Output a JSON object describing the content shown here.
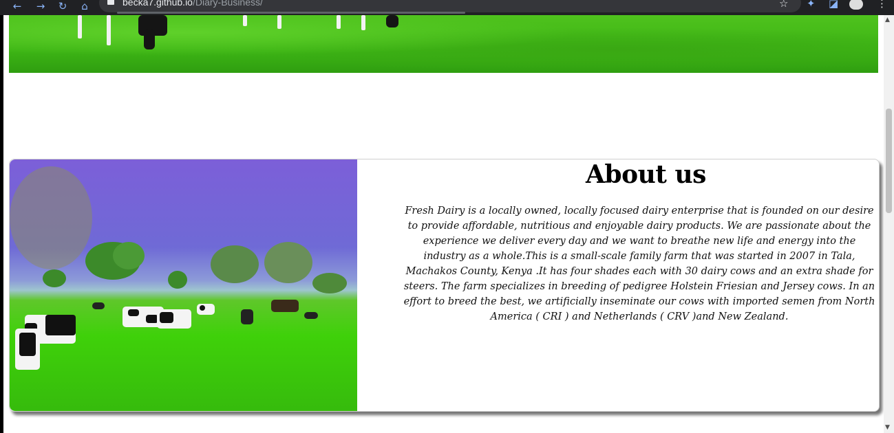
{
  "browser": {
    "url_host": "becka7.github.io",
    "url_path": "/Diary-Business/",
    "back_icon": "arrow-left-icon",
    "forward_icon": "arrow-right-icon",
    "reload_icon": "reload-icon",
    "home_icon": "home-icon",
    "lock_icon": "lock-icon",
    "star_icon": "star-icon",
    "extensions_icon": "puzzle-icon",
    "cast_icon": "cast-icon",
    "menu_icon": "kebab-menu-icon"
  },
  "about": {
    "title": "About us",
    "body": "Fresh Dairy is a locally owned, locally focused dairy enterprise that is founded on our desire to provide affordable, nutritious and enjoyable dairy products. We are passionate about the experience we deliver every day and we want to breathe new life and energy into the industry as a whole.This is a small-scale family farm that was started in 2007 in Tala, Machakos County, Kenya .It has four shades each with 30 dairy cows and an extra shade for steers. The farm specializes in breeding of pedigree Holstein Friesian and Jersey cows. In an effort to breed the best, we artificially inseminate our cows with imported semen from North America ( CRI ) and Netherlands ( CRV )and New Zealand."
  },
  "images": {
    "hero": "cows-grazing-grass-banner",
    "about": "holstein-cows-in-green-pasture"
  }
}
